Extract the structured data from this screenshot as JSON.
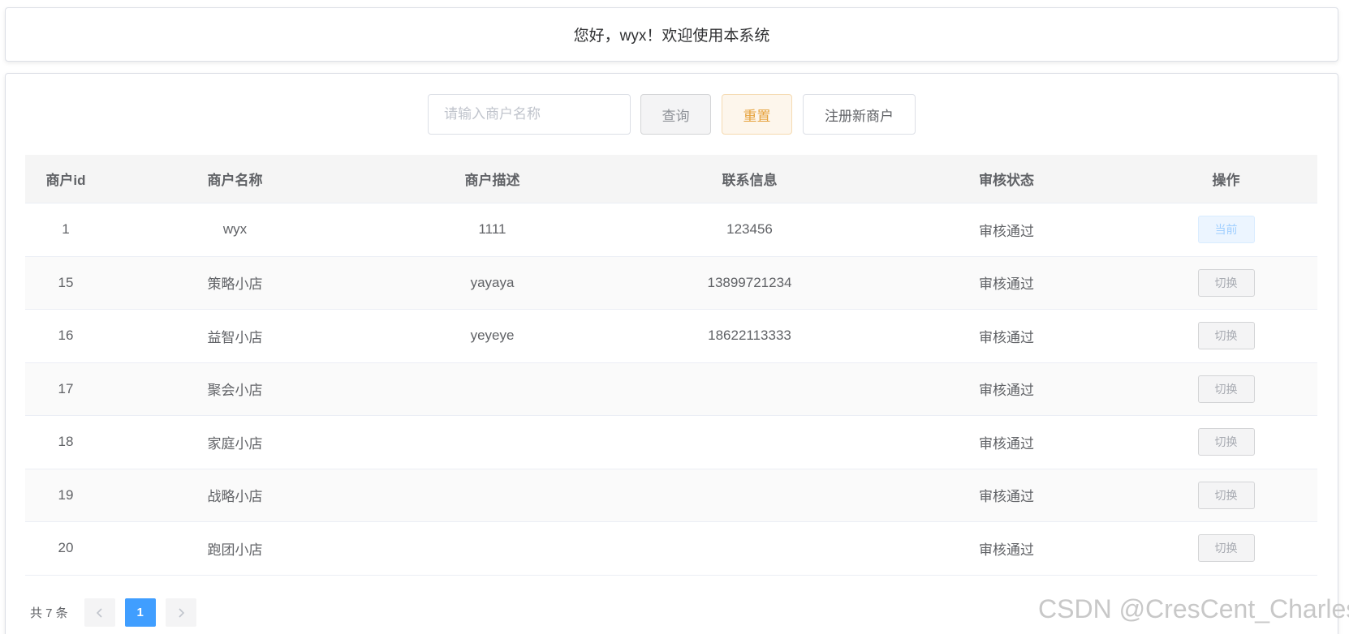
{
  "header": {
    "welcome": "您好，wyx！欢迎使用本系统"
  },
  "search": {
    "placeholder": "请输入商户名称",
    "value": ""
  },
  "buttons": {
    "query": "查询",
    "reset": "重置",
    "register": "注册新商户"
  },
  "table": {
    "columns": [
      "商户id",
      "商户名称",
      "商户描述",
      "联系信息",
      "审核状态",
      "操作"
    ],
    "rows": [
      {
        "id": "1",
        "name": "wyx",
        "desc": "1111",
        "contact": "123456",
        "status": "审核通过",
        "action": "当前"
      },
      {
        "id": "15",
        "name": "策略小店",
        "desc": "yayaya",
        "contact": "13899721234",
        "status": "审核通过",
        "action": "切换"
      },
      {
        "id": "16",
        "name": "益智小店",
        "desc": "yeyeye",
        "contact": "18622113333",
        "status": "审核通过",
        "action": "切换"
      },
      {
        "id": "17",
        "name": "聚会小店",
        "desc": "",
        "contact": "",
        "status": "审核通过",
        "action": "切换"
      },
      {
        "id": "18",
        "name": "家庭小店",
        "desc": "",
        "contact": "",
        "status": "审核通过",
        "action": "切换"
      },
      {
        "id": "19",
        "name": "战略小店",
        "desc": "",
        "contact": "",
        "status": "审核通过",
        "action": "切换"
      },
      {
        "id": "20",
        "name": "跑团小店",
        "desc": "",
        "contact": "",
        "status": "审核通过",
        "action": "切换"
      }
    ]
  },
  "pagination": {
    "total": "共 7 条",
    "current_page": "1",
    "prev_icon": "chevron-left-icon",
    "next_icon": "chevron-right-icon"
  },
  "watermark": "CSDN @CresCent_Charles",
  "colors": {
    "primary": "#409eff",
    "warning": "#e6a23c",
    "info": "#909399"
  }
}
